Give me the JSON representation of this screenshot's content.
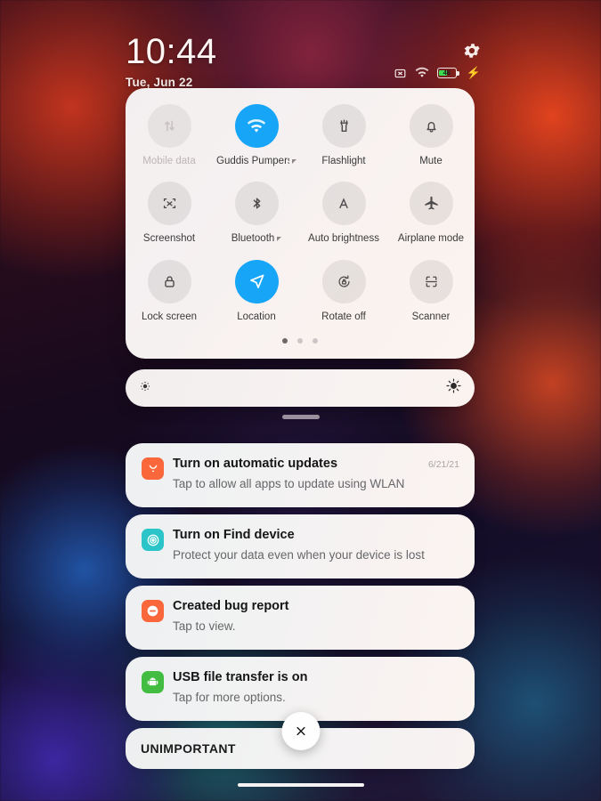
{
  "statusbar": {
    "time": "10:44",
    "date": "Tue, Jun 22",
    "gear_icon": "gear-icon",
    "icons": [
      {
        "name": "no-sim-icon",
        "label": ""
      },
      {
        "name": "wifi-icon",
        "label": ""
      }
    ],
    "battery": {
      "percent": "46",
      "level": 46,
      "charging": true,
      "fill_color": "#3ddc50"
    }
  },
  "quick_settings": {
    "accent_color": "#17a5f7",
    "rows": [
      [
        {
          "label": "Mobile data",
          "icon": "mobile-data-icon",
          "state": "disabled"
        },
        {
          "label": "Guddis Pumpers",
          "icon": "wifi-icon",
          "state": "on",
          "caret": true
        },
        {
          "label": "Flashlight",
          "icon": "flashlight-icon",
          "state": "off"
        },
        {
          "label": "Mute",
          "icon": "bell-icon",
          "state": "off"
        }
      ],
      [
        {
          "label": "Screenshot",
          "icon": "screenshot-icon",
          "state": "off"
        },
        {
          "label": "Bluetooth",
          "icon": "bluetooth-icon",
          "state": "off",
          "caret": true
        },
        {
          "label": "Auto brightness",
          "icon": "auto-brightness-icon",
          "state": "off"
        },
        {
          "label": "Airplane mode",
          "icon": "airplane-icon",
          "state": "off"
        }
      ],
      [
        {
          "label": "Lock screen",
          "icon": "lock-icon",
          "state": "off"
        },
        {
          "label": "Location",
          "icon": "location-arrow-icon",
          "state": "on"
        },
        {
          "label": "Rotate off",
          "icon": "rotate-lock-icon",
          "state": "off"
        },
        {
          "label": "Scanner",
          "icon": "scanner-icon",
          "state": "off"
        }
      ]
    ],
    "page_dots": {
      "count": 3,
      "active": 0
    }
  },
  "brightness": {
    "low_icon": "brightness-low-icon",
    "high_icon": "brightness-high-icon",
    "level": 100
  },
  "notifications": [
    {
      "title": "Turn on automatic updates",
      "body": "Tap to allow all apps to update using WLAN",
      "time": "6/21/21",
      "icon": "app-store-icon",
      "icon_color": "#f9673a"
    },
    {
      "title": "Turn on Find device",
      "body": "Protect your data even when your device is lost",
      "time": "",
      "icon": "find-device-icon",
      "icon_color": "#2ac4c9"
    },
    {
      "title": "Created bug report",
      "body": "Tap to view.",
      "time": "",
      "icon": "bug-report-icon",
      "icon_color": "#f9673a"
    },
    {
      "title": "USB file transfer is on",
      "body": "Tap for more options.",
      "time": "",
      "icon": "android-robot-icon",
      "icon_color": "#42bd41"
    }
  ],
  "unimportant": {
    "label": "UNIMPORTANT"
  },
  "clear_all": {
    "icon": "close-icon",
    "glyph": "✕"
  }
}
